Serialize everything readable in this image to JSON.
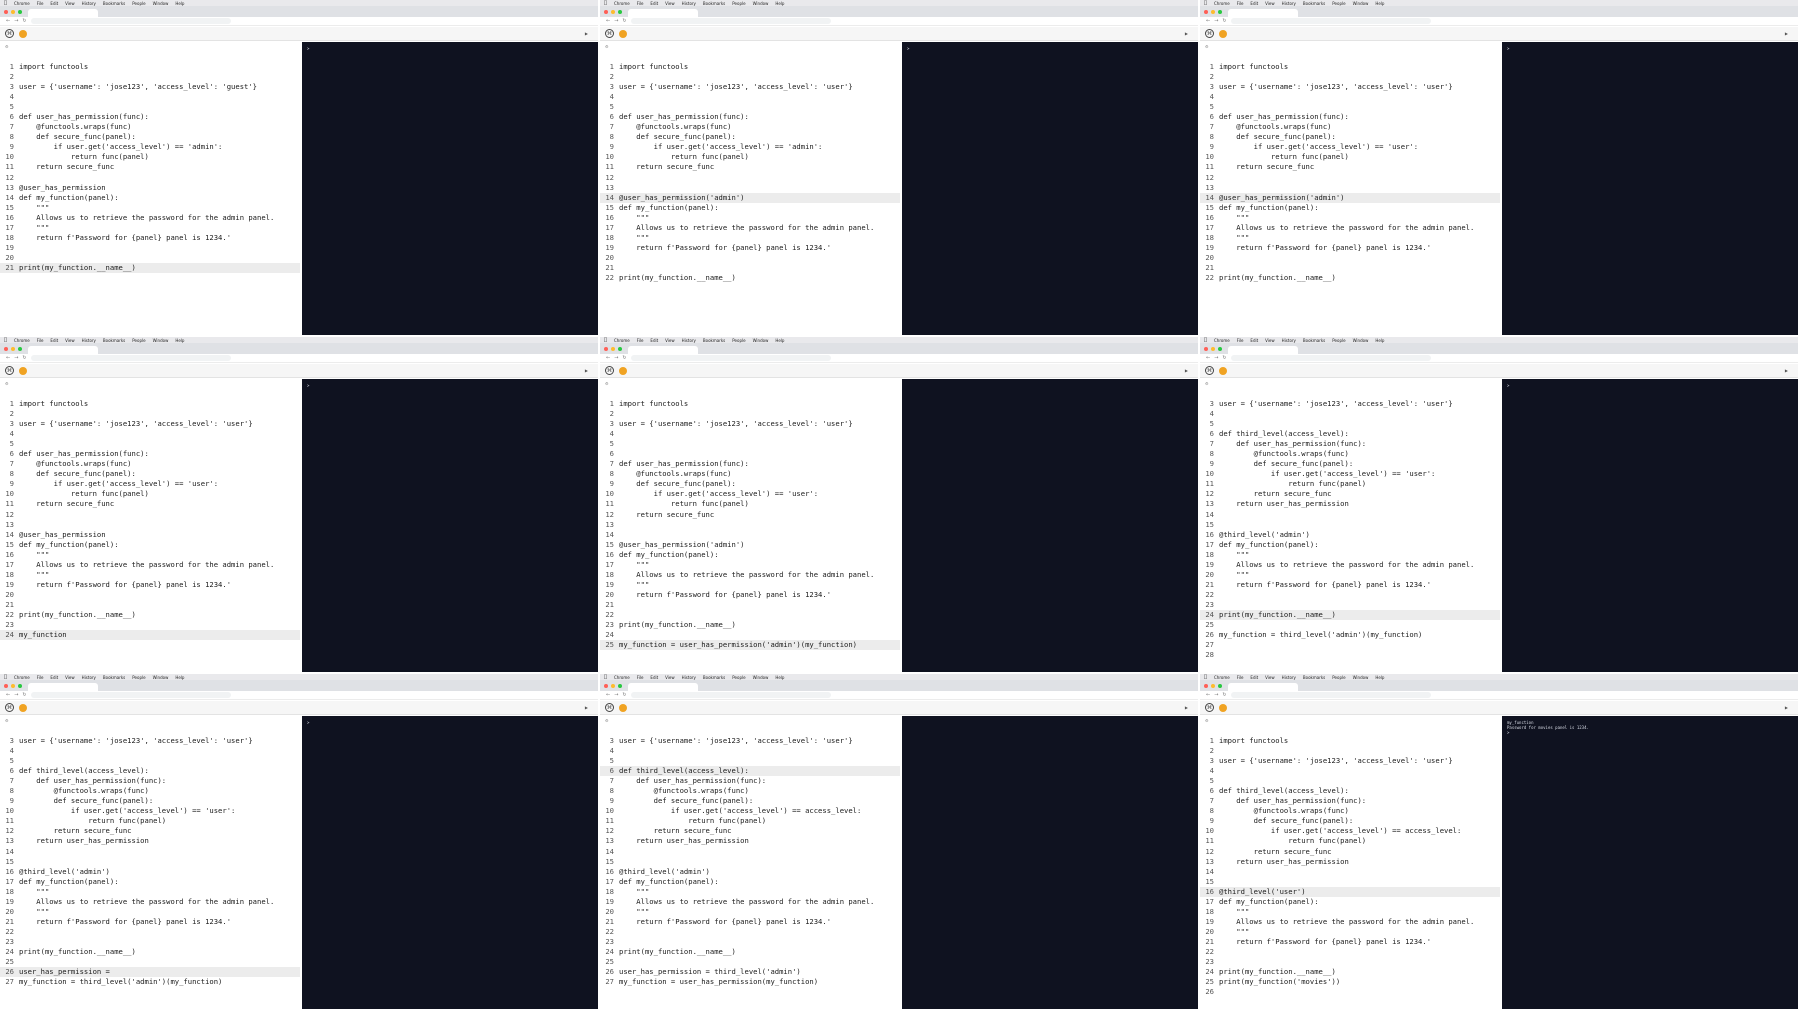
{
  "colors": {
    "console_bg": "#0f1220",
    "editor_bg": "#ffffff",
    "active_line": "#ececec",
    "menubar": "#e9e9ec"
  },
  "menubar": {
    "items": [
      "Chrome",
      "File",
      "Edit",
      "View",
      "History",
      "Bookmarks",
      "People",
      "Window",
      "Help"
    ]
  },
  "frames": [
    {
      "lines": [
        [
          "1",
          "import functools"
        ],
        [
          "2",
          ""
        ],
        [
          "3",
          "user = {'username': 'jose123', 'access_level': 'guest'}"
        ],
        [
          "4",
          ""
        ],
        [
          "5",
          ""
        ],
        [
          "6",
          "def user_has_permission(func):"
        ],
        [
          "7",
          "    @functools.wraps(func)"
        ],
        [
          "8",
          "    def secure_func(panel):"
        ],
        [
          "9",
          "        if user.get('access_level') == 'admin':"
        ],
        [
          "10",
          "            return func(panel)"
        ],
        [
          "11",
          "    return secure_func"
        ],
        [
          "12",
          ""
        ],
        [
          "13",
          "@user_has_permission"
        ],
        [
          "14",
          "def my_function(panel):"
        ],
        [
          "15",
          "    \"\"\""
        ],
        [
          "16",
          "    Allows us to retrieve the password for the admin panel."
        ],
        [
          "17",
          "    \"\"\""
        ],
        [
          "18",
          "    return f'Password for {panel} panel is 1234.'"
        ],
        [
          "19",
          ""
        ],
        [
          "20",
          ""
        ],
        [
          "21",
          "print(my_function.__name__)"
        ]
      ],
      "active": 20,
      "console": [
        ">"
      ]
    },
    {
      "lines": [
        [
          "1",
          "import functools"
        ],
        [
          "2",
          ""
        ],
        [
          "3",
          "user = {'username': 'jose123', 'access_level': 'user'}"
        ],
        [
          "4",
          ""
        ],
        [
          "5",
          ""
        ],
        [
          "6",
          "def user_has_permission(func):"
        ],
        [
          "7",
          "    @functools.wraps(func)"
        ],
        [
          "8",
          "    def secure_func(panel):"
        ],
        [
          "9",
          "        if user.get('access_level') == 'admin':"
        ],
        [
          "10",
          "            return func(panel)"
        ],
        [
          "11",
          "    return secure_func"
        ],
        [
          "12",
          ""
        ],
        [
          "13",
          ""
        ],
        [
          "14",
          "@user_has_permission('admin')"
        ],
        [
          "15",
          "def my_function(panel):"
        ],
        [
          "16",
          "    \"\"\""
        ],
        [
          "17",
          "    Allows us to retrieve the password for the admin panel."
        ],
        [
          "18",
          "    \"\"\""
        ],
        [
          "19",
          "    return f'Password for {panel} panel is 1234.'"
        ],
        [
          "20",
          ""
        ],
        [
          "21",
          ""
        ],
        [
          "22",
          "print(my_function.__name__)"
        ]
      ],
      "active": 13,
      "console": [
        ">"
      ]
    },
    {
      "lines": [
        [
          "1",
          "import functools"
        ],
        [
          "2",
          ""
        ],
        [
          "3",
          "user = {'username': 'jose123', 'access_level': 'user'}"
        ],
        [
          "4",
          ""
        ],
        [
          "5",
          ""
        ],
        [
          "6",
          "def user_has_permission(func):"
        ],
        [
          "7",
          "    @functools.wraps(func)"
        ],
        [
          "8",
          "    def secure_func(panel):"
        ],
        [
          "9",
          "        if user.get('access_level') == 'user':"
        ],
        [
          "10",
          "            return func(panel)"
        ],
        [
          "11",
          "    return secure_func"
        ],
        [
          "12",
          ""
        ],
        [
          "13",
          ""
        ],
        [
          "14",
          "@user_has_permission('admin')"
        ],
        [
          "15",
          "def my_function(panel):"
        ],
        [
          "16",
          "    \"\"\""
        ],
        [
          "17",
          "    Allows us to retrieve the password for the admin panel."
        ],
        [
          "18",
          "    \"\"\""
        ],
        [
          "19",
          "    return f'Password for {panel} panel is 1234.'"
        ],
        [
          "20",
          ""
        ],
        [
          "21",
          ""
        ],
        [
          "22",
          "print(my_function.__name__)"
        ]
      ],
      "active": 13,
      "console": [
        ">"
      ]
    },
    {
      "lines": [
        [
          "1",
          "import functools"
        ],
        [
          "2",
          ""
        ],
        [
          "3",
          "user = {'username': 'jose123', 'access_level': 'user'}"
        ],
        [
          "4",
          ""
        ],
        [
          "5",
          ""
        ],
        [
          "6",
          "def user_has_permission(func):"
        ],
        [
          "7",
          "    @functools.wraps(func)"
        ],
        [
          "8",
          "    def secure_func(panel):"
        ],
        [
          "9",
          "        if user.get('access_level') == 'user':"
        ],
        [
          "10",
          "            return func(panel)"
        ],
        [
          "11",
          "    return secure_func"
        ],
        [
          "12",
          ""
        ],
        [
          "13",
          ""
        ],
        [
          "14",
          "@user_has_permission"
        ],
        [
          "15",
          "def my_function(panel):"
        ],
        [
          "16",
          "    \"\"\""
        ],
        [
          "17",
          "    Allows us to retrieve the password for the admin panel."
        ],
        [
          "18",
          "    \"\"\""
        ],
        [
          "19",
          "    return f'Password for {panel} panel is 1234.'"
        ],
        [
          "20",
          ""
        ],
        [
          "21",
          ""
        ],
        [
          "22",
          "print(my_function.__name__)"
        ],
        [
          "23",
          ""
        ],
        [
          "24",
          "my_function"
        ]
      ],
      "active": 23,
      "console": [
        ">"
      ]
    },
    {
      "lines": [
        [
          "1",
          "import functools"
        ],
        [
          "2",
          ""
        ],
        [
          "3",
          "user = {'username': 'jose123', 'access_level': 'user'}"
        ],
        [
          "4",
          ""
        ],
        [
          "5",
          ""
        ],
        [
          "6",
          ""
        ],
        [
          "7",
          "def user_has_permission(func):"
        ],
        [
          "8",
          "    @functools.wraps(func)"
        ],
        [
          "9",
          "    def secure_func(panel):"
        ],
        [
          "10",
          "        if user.get('access_level') == 'user':"
        ],
        [
          "11",
          "            return func(panel)"
        ],
        [
          "12",
          "    return secure_func"
        ],
        [
          "13",
          ""
        ],
        [
          "14",
          ""
        ],
        [
          "15",
          "@user_has_permission('admin')"
        ],
        [
          "16",
          "def my_function(panel):"
        ],
        [
          "17",
          "    \"\"\""
        ],
        [
          "18",
          "    Allows us to retrieve the password for the admin panel."
        ],
        [
          "19",
          "    \"\"\""
        ],
        [
          "20",
          "    return f'Password for {panel} panel is 1234.'"
        ],
        [
          "21",
          ""
        ],
        [
          "22",
          ""
        ],
        [
          "23",
          "print(my_function.__name__)"
        ],
        [
          "24",
          ""
        ],
        [
          "25",
          "my_function = user_has_permission('admin')(my_function)"
        ]
      ],
      "active": 24,
      "console": []
    },
    {
      "lines": [
        [
          "3",
          "user = {'username': 'jose123', 'access_level': 'user'}"
        ],
        [
          "4",
          ""
        ],
        [
          "5",
          ""
        ],
        [
          "6",
          "def third_level(access_level):"
        ],
        [
          "7",
          "    def user_has_permission(func):"
        ],
        [
          "8",
          "        @functools.wraps(func)"
        ],
        [
          "9",
          "        def secure_func(panel):"
        ],
        [
          "10",
          "            if user.get('access_level') == 'user':"
        ],
        [
          "11",
          "                return func(panel)"
        ],
        [
          "12",
          "        return secure_func"
        ],
        [
          "13",
          "    return user_has_permission"
        ],
        [
          "14",
          ""
        ],
        [
          "15",
          ""
        ],
        [
          "16",
          "@third_level('admin')"
        ],
        [
          "17",
          "def my_function(panel):"
        ],
        [
          "18",
          "    \"\"\""
        ],
        [
          "19",
          "    Allows us to retrieve the password for the admin panel."
        ],
        [
          "20",
          "    \"\"\""
        ],
        [
          "21",
          "    return f'Password for {panel} panel is 1234.'"
        ],
        [
          "22",
          ""
        ],
        [
          "23",
          ""
        ],
        [
          "24",
          "print(my_function.__name__)"
        ],
        [
          "25",
          ""
        ],
        [
          "26",
          "my_function = third_level('admin')(my_function)"
        ],
        [
          "27",
          ""
        ],
        [
          "28",
          ""
        ]
      ],
      "active": 21,
      "console": [
        ">"
      ]
    },
    {
      "lines": [
        [
          "3",
          "user = {'username': 'jose123', 'access_level': 'user'}"
        ],
        [
          "4",
          ""
        ],
        [
          "5",
          ""
        ],
        [
          "6",
          "def third_level(access_level):"
        ],
        [
          "7",
          "    def user_has_permission(func):"
        ],
        [
          "8",
          "        @functools.wraps(func)"
        ],
        [
          "9",
          "        def secure_func(panel):"
        ],
        [
          "10",
          "            if user.get('access_level') == 'user':"
        ],
        [
          "11",
          "                return func(panel)"
        ],
        [
          "12",
          "        return secure_func"
        ],
        [
          "13",
          "    return user_has_permission"
        ],
        [
          "14",
          ""
        ],
        [
          "15",
          ""
        ],
        [
          "16",
          "@third_level('admin')"
        ],
        [
          "17",
          "def my_function(panel):"
        ],
        [
          "18",
          "    \"\"\""
        ],
        [
          "19",
          "    Allows us to retrieve the password for the admin panel."
        ],
        [
          "20",
          "    \"\"\""
        ],
        [
          "21",
          "    return f'Password for {panel} panel is 1234.'"
        ],
        [
          "22",
          ""
        ],
        [
          "23",
          ""
        ],
        [
          "24",
          "print(my_function.__name__)"
        ],
        [
          "25",
          ""
        ],
        [
          "26",
          "user_has_permission = "
        ],
        [
          "27",
          "my_function = third_level('admin')(my_function)"
        ]
      ],
      "active": 23,
      "console": [
        ">"
      ]
    },
    {
      "lines": [
        [
          "3",
          "user = {'username': 'jose123', 'access_level': 'user'}"
        ],
        [
          "4",
          ""
        ],
        [
          "5",
          ""
        ],
        [
          "6",
          "def third_level(access_level):"
        ],
        [
          "7",
          "    def user_has_permission(func):"
        ],
        [
          "8",
          "        @functools.wraps(func)"
        ],
        [
          "9",
          "        def secure_func(panel):"
        ],
        [
          "10",
          "            if user.get('access_level') == access_level:"
        ],
        [
          "11",
          "                return func(panel)"
        ],
        [
          "12",
          "        return secure_func"
        ],
        [
          "13",
          "    return user_has_permission"
        ],
        [
          "14",
          ""
        ],
        [
          "15",
          ""
        ],
        [
          "16",
          "@third_level('admin')"
        ],
        [
          "17",
          "def my_function(panel):"
        ],
        [
          "18",
          "    \"\"\""
        ],
        [
          "19",
          "    Allows us to retrieve the password for the admin panel."
        ],
        [
          "20",
          "    \"\"\""
        ],
        [
          "21",
          "    return f'Password for {panel} panel is 1234.'"
        ],
        [
          "22",
          ""
        ],
        [
          "23",
          ""
        ],
        [
          "24",
          "print(my_function.__name__)"
        ],
        [
          "25",
          ""
        ],
        [
          "26",
          "user_has_permission = third_level('admin')"
        ],
        [
          "27",
          "my_function = user_has_permission(my_function)"
        ]
      ],
      "active": 3,
      "console": []
    },
    {
      "lines": [
        [
          "1",
          "import functools"
        ],
        [
          "2",
          ""
        ],
        [
          "3",
          "user = {'username': 'jose123', 'access_level': 'user'}"
        ],
        [
          "4",
          ""
        ],
        [
          "5",
          ""
        ],
        [
          "6",
          "def third_level(access_level):"
        ],
        [
          "7",
          "    def user_has_permission(func):"
        ],
        [
          "8",
          "        @functools.wraps(func)"
        ],
        [
          "9",
          "        def secure_func(panel):"
        ],
        [
          "10",
          "            if user.get('access_level') == access_level:"
        ],
        [
          "11",
          "                return func(panel)"
        ],
        [
          "12",
          "        return secure_func"
        ],
        [
          "13",
          "    return user_has_permission"
        ],
        [
          "14",
          ""
        ],
        [
          "15",
          ""
        ],
        [
          "16",
          "@third_level('user')"
        ],
        [
          "17",
          "def my_function(panel):"
        ],
        [
          "18",
          "    \"\"\""
        ],
        [
          "19",
          "    Allows us to retrieve the password for the admin panel."
        ],
        [
          "20",
          "    \"\"\""
        ],
        [
          "21",
          "    return f'Password for {panel} panel is 1234.'"
        ],
        [
          "22",
          ""
        ],
        [
          "23",
          ""
        ],
        [
          "24",
          "print(my_function.__name__)"
        ],
        [
          "25",
          "print(my_function('movies'))"
        ],
        [
          "26",
          ""
        ]
      ],
      "active": 15,
      "console": [
        "my_function",
        "Password for movies panel is 1234.",
        ">"
      ]
    }
  ]
}
